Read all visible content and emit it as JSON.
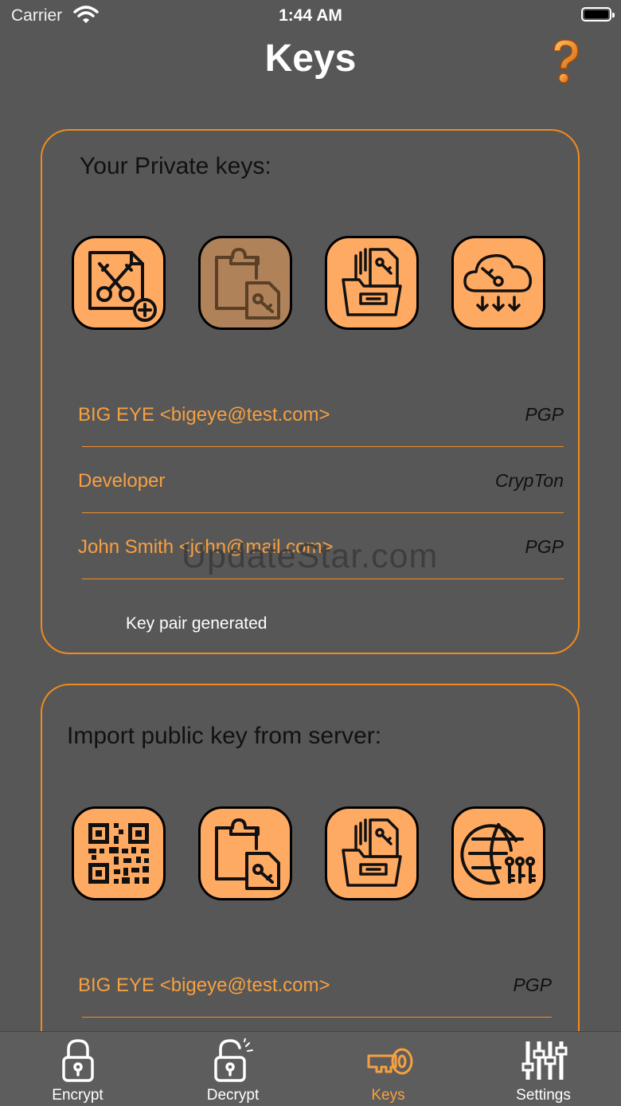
{
  "status_bar": {
    "carrier": "Carrier",
    "time": "1:44 AM"
  },
  "header": {
    "title": "Keys",
    "help_icon": "question-mark-icon"
  },
  "private_keys": {
    "heading": "Your Private keys:",
    "actions": [
      {
        "icon": "generate-key-icon",
        "enabled": true
      },
      {
        "icon": "paste-key-icon",
        "enabled": false
      },
      {
        "icon": "import-file-key-icon",
        "enabled": true
      },
      {
        "icon": "cloud-download-key-icon",
        "enabled": true
      }
    ],
    "keys": [
      {
        "name": "BIG EYE <bigeye@test.com>",
        "type": "PGP"
      },
      {
        "name": "Developer",
        "type": "CrypTon"
      },
      {
        "name": "John Smith <john@mail.com>",
        "type": "PGP"
      }
    ],
    "status_message": "Key pair generated"
  },
  "public_keys": {
    "heading": "Import public key from server:",
    "actions": [
      {
        "icon": "qr-code-icon",
        "enabled": true
      },
      {
        "icon": "paste-key-icon",
        "enabled": true
      },
      {
        "icon": "import-file-key-icon",
        "enabled": true
      },
      {
        "icon": "globe-keys-icon",
        "enabled": true
      }
    ],
    "keys": [
      {
        "name": "BIG EYE <bigeye@test.com>",
        "type": "PGP"
      }
    ]
  },
  "watermark": "UpdateStar.com",
  "tab_bar": {
    "tabs": [
      {
        "label": "Encrypt",
        "icon": "lock-icon",
        "active": false
      },
      {
        "label": "Decrypt",
        "icon": "unlock-icon",
        "active": false
      },
      {
        "label": "Keys",
        "icon": "key-icon",
        "active": true
      },
      {
        "label": "Settings",
        "icon": "sliders-icon",
        "active": false
      }
    ]
  },
  "colors": {
    "background": "#575757",
    "accent": "#f08b1d",
    "button_fill": "#ffaa63",
    "button_disabled": "#b0825a",
    "key_text": "#f7a041"
  }
}
